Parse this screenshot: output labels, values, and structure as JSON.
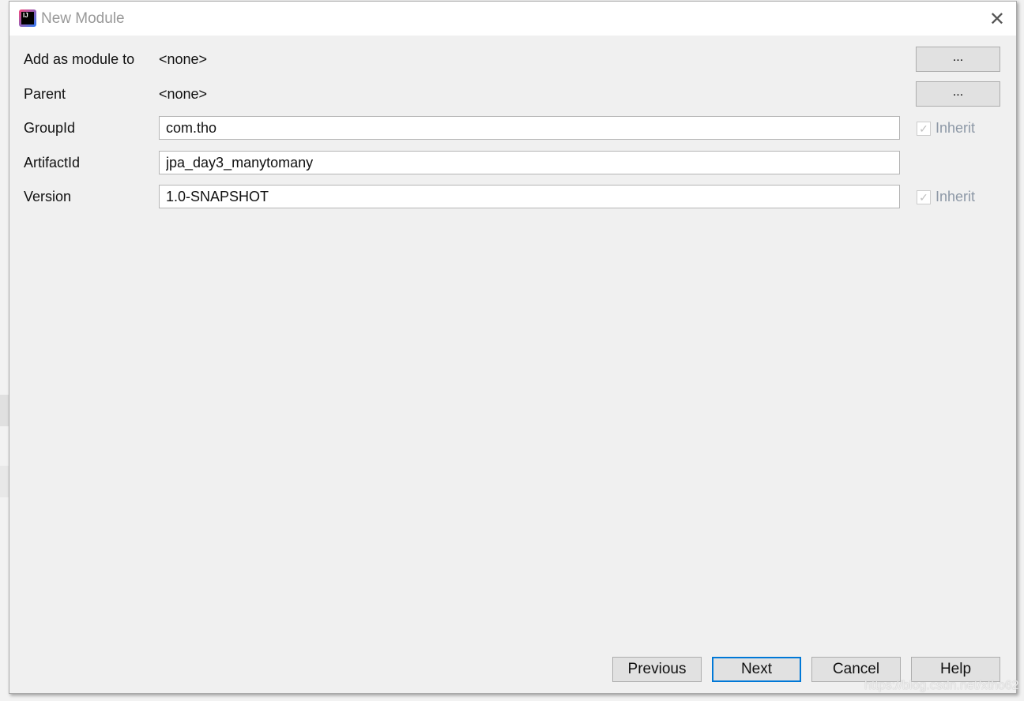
{
  "dialog": {
    "title": "New Module",
    "close_label": "✕",
    "logo_text": "IJ"
  },
  "form": {
    "add_as_module_to": {
      "label": "Add as module to",
      "value": "<none>",
      "button": "..."
    },
    "parent": {
      "label": "Parent",
      "value": "<none>",
      "button": "..."
    },
    "group_id": {
      "label": "GroupId",
      "value": "com.tho",
      "inherit_label": "Inherit",
      "inherit_checked": true
    },
    "artifact_id": {
      "label": "ArtifactId",
      "value": "jpa_day3_manytomany"
    },
    "version": {
      "label": "Version",
      "value": "1.0-SNAPSHOT",
      "inherit_label": "Inherit",
      "inherit_checked": true
    }
  },
  "buttons": {
    "previous": "Previous",
    "next": "Next",
    "cancel": "Cancel",
    "help": "Help"
  },
  "watermark": "https://blog.csdn.net/xtho62",
  "colors": {
    "accent": "#0078d7",
    "disabled_text": "#8d98a6"
  }
}
